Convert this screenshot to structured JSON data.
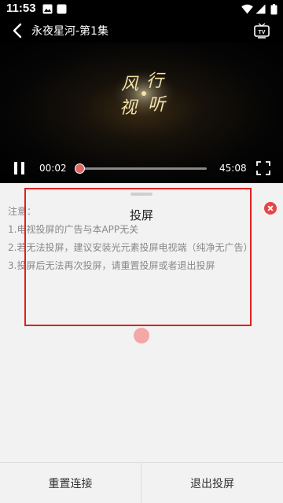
{
  "status_bar": {
    "time": "11:53",
    "icons": [
      "gallery-icon",
      "square-icon",
      "wifi-icon",
      "signal-icon",
      "battery-icon"
    ]
  },
  "header": {
    "title": "永夜星河-第1集",
    "back_icon": "chevron-left-icon",
    "tv_icon": "tv-icon"
  },
  "player": {
    "current_time": "00:02",
    "total_time": "45:08",
    "progress": 0.01,
    "logo_text": "风行视听",
    "pause_icon": "pause-icon",
    "fullscreen_icon": "fullscreen-icon"
  },
  "cast_panel": {
    "title": "投屏",
    "notes": [
      "注意：",
      "1.电视投屏的广告与本APP无关",
      "2.若无法投屏，建议安装光元素投屏电视端（纯净无广告）",
      "3.投屏后无法再次投屏，请重置投屏或者退出投屏"
    ],
    "close_icon": "close-icon"
  },
  "actions": {
    "reset_label": "重置连接",
    "exit_label": "退出投屏"
  },
  "colors": {
    "accent_red": "#e02020",
    "close_red": "#e64545",
    "progress_thumb": "#d86a6a"
  }
}
